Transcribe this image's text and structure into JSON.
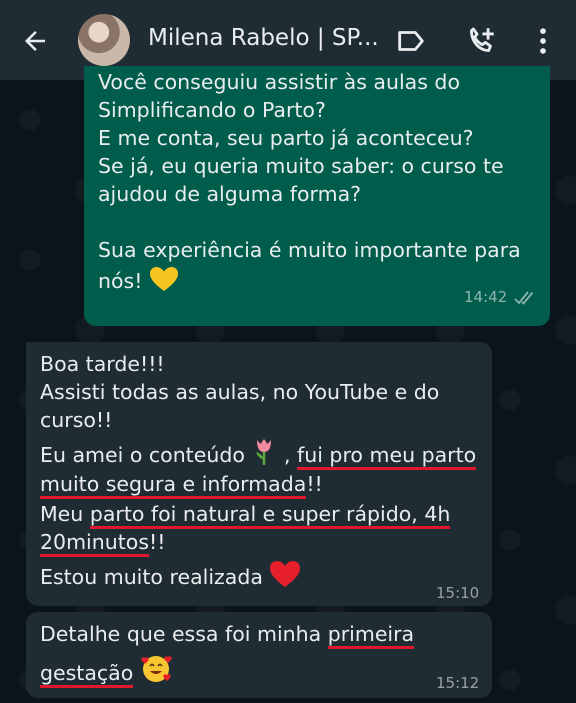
{
  "header": {
    "contact_name": "Milena Rabelo | SP...",
    "icons": [
      "back-arrow-icon",
      "label-icon",
      "add-call-icon",
      "more-vertical-icon"
    ]
  },
  "messages": {
    "outgoing": {
      "lines": [
        "Você conseguiu assistir às aulas do",
        "Simplificando o Parto?",
        "E me conta, seu parto já aconteceu?",
        "Se já, eu queria muito saber: o curso te",
        "ajudou de alguma forma?",
        "Sua experiência é muito importante para",
        "nós!"
      ],
      "time": "14:42"
    },
    "incoming1": {
      "l1": "Boa tarde!!!",
      "l2": "Assisti todas as aulas, no YouTube e do",
      "l3": "curso!!",
      "l4a": "Eu amei o conteúdo",
      "l4b": ",",
      "l4c": "fui pro meu parto",
      "l5a": "muito segura e informada",
      "l5b": "!!",
      "l6a": "Meu",
      "l6b": "parto foi natural e super rápido, 4h",
      "l7a": "20minutos",
      "l7b": "!!",
      "l8": "Estou muito realizada",
      "time": "15:10"
    },
    "incoming2": {
      "l1a": "Detalhe que essa foi minha",
      "l1b": "primeira",
      "l2a": "gestação",
      "time": "15:12"
    }
  },
  "colors": {
    "header_bg": "#1f2c34",
    "chat_bg": "#0b141a",
    "outgoing_bubble": "#005c4b",
    "incoming_bubble": "#202c33",
    "highlight_underline": "#e0182d"
  }
}
